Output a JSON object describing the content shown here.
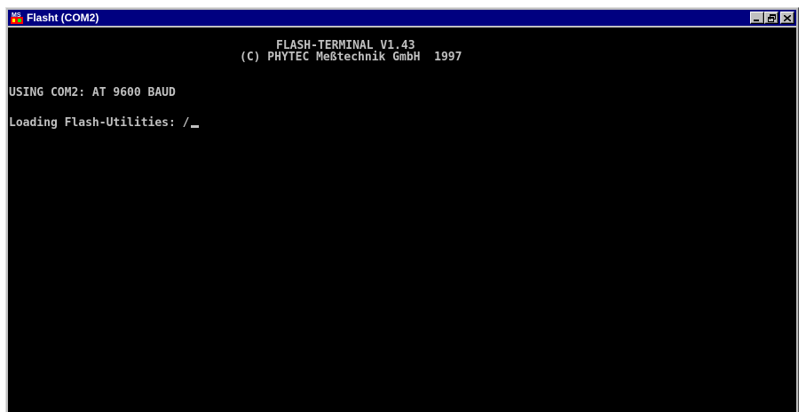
{
  "window": {
    "title": "Flasht (COM2)",
    "icon": "ms-dos-icon",
    "icon_text": "MS",
    "controls": [
      "minimize",
      "maximize",
      "close"
    ]
  },
  "console": {
    "header_line1": "FLASH-TERMINAL V1.43",
    "header_line2": "(C) PHYTEC Meßtechnik GmbH  1997",
    "status_line": "USING COM2: AT 9600 BAUD",
    "loading_line": "Loading Flash-Utilities: /",
    "text_color": "#c0c0c0",
    "background_color": "#000000"
  },
  "colors": {
    "titlebar": "#000080",
    "window_frame": "#c0c0c0"
  }
}
